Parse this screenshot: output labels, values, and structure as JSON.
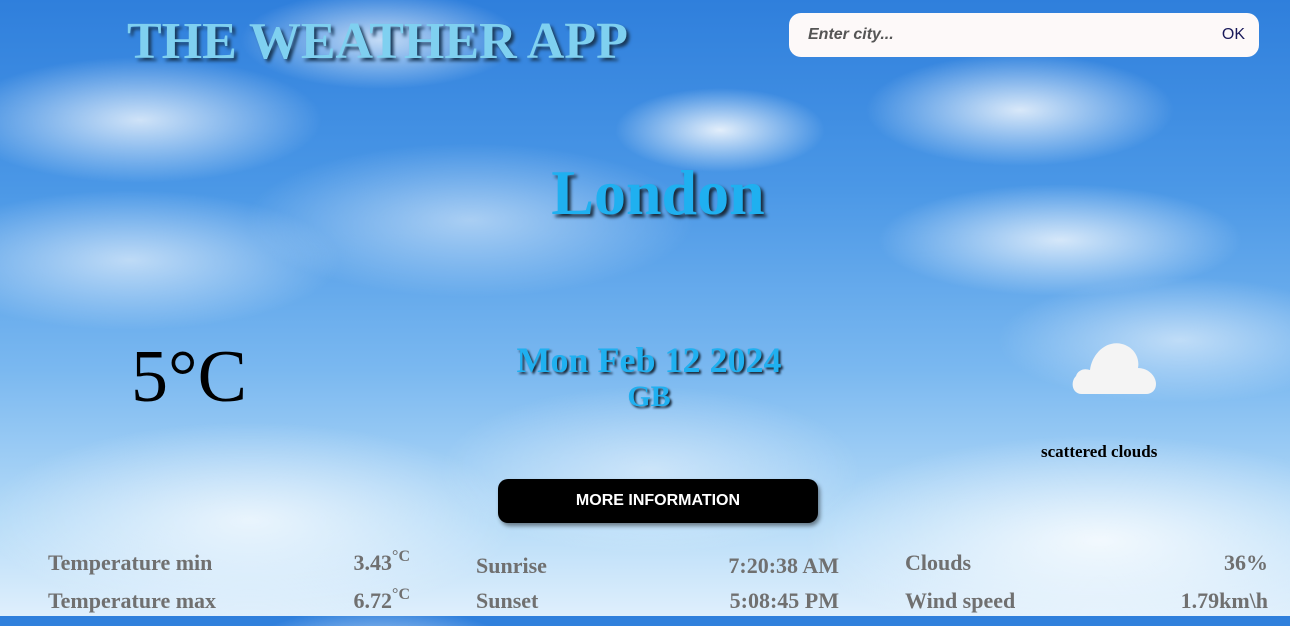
{
  "header": {
    "app_title": "THE WEATHER APP",
    "search": {
      "placeholder": "Enter city...",
      "value": "",
      "submit_label": "OK"
    }
  },
  "current": {
    "city": "London",
    "temperature": "5°C",
    "date": "Mon Feb 12 2024",
    "country": "GB",
    "description": "scattered clouds",
    "icon": "cloud-icon"
  },
  "more_button_label": "MORE INFORMATION",
  "details": {
    "temperature": [
      {
        "label": "Temperature min",
        "value": "3.43",
        "unit": "°C"
      },
      {
        "label": "Temperature max",
        "value": "6.72",
        "unit": "°C"
      }
    ],
    "sun": [
      {
        "label": "Sunrise",
        "value": "7:20:38 AM"
      },
      {
        "label": "Sunset",
        "value": "5:08:45 PM"
      }
    ],
    "conditions": [
      {
        "label": "Clouds",
        "value": "36%"
      },
      {
        "label": "Wind speed",
        "value": "1.79km\\h"
      }
    ]
  },
  "colors": {
    "title": "#7fd0f0",
    "accent": "#1fb0f0",
    "button_bg": "#000000",
    "detail_text": "#707070"
  }
}
